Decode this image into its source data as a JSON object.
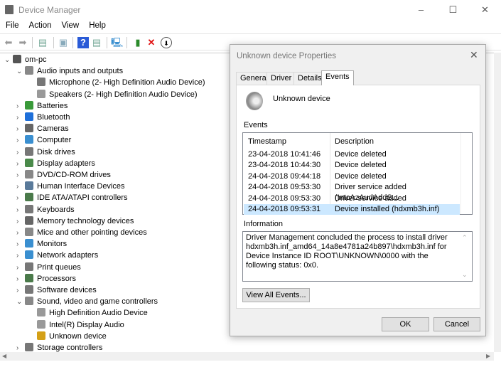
{
  "window": {
    "title": "Device Manager",
    "minimize": "–",
    "maximize": "☐",
    "close": "✕"
  },
  "menu": [
    "File",
    "Action",
    "View",
    "Help"
  ],
  "toolbar": [
    "back-icon",
    "forward-icon",
    "properties-icon",
    "show-hidden-icon",
    "help-icon",
    "run-icon",
    "scan-icon",
    "enable-icon",
    "uninstall-icon",
    "update-driver-icon"
  ],
  "tree": [
    {
      "label": "om-pc",
      "level": 0,
      "exp": "⌄",
      "icon": "#555"
    },
    {
      "label": "Audio inputs and outputs",
      "level": 1,
      "exp": "⌄",
      "icon": "#888"
    },
    {
      "label": "Microphone (2- High Definition Audio Device)",
      "level": 2,
      "exp": "",
      "icon": "#777"
    },
    {
      "label": "Speakers (2- High Definition Audio Device)",
      "level": 2,
      "exp": "",
      "icon": "#999"
    },
    {
      "label": "Batteries",
      "level": 1,
      "exp": "›",
      "icon": "#3a9a3a"
    },
    {
      "label": "Bluetooth",
      "level": 1,
      "exp": "›",
      "icon": "#1e6fd9"
    },
    {
      "label": "Cameras",
      "level": 1,
      "exp": "›",
      "icon": "#666"
    },
    {
      "label": "Computer",
      "level": 1,
      "exp": "›",
      "icon": "#3a8fd0"
    },
    {
      "label": "Disk drives",
      "level": 1,
      "exp": "›",
      "icon": "#777"
    },
    {
      "label": "Display adapters",
      "level": 1,
      "exp": "›",
      "icon": "#4a8a4a"
    },
    {
      "label": "DVD/CD-ROM drives",
      "level": 1,
      "exp": "›",
      "icon": "#888"
    },
    {
      "label": "Human Interface Devices",
      "level": 1,
      "exp": "›",
      "icon": "#5a7a9a"
    },
    {
      "label": "IDE ATA/ATAPI controllers",
      "level": 1,
      "exp": "›",
      "icon": "#4a7a4a"
    },
    {
      "label": "Keyboards",
      "level": 1,
      "exp": "›",
      "icon": "#777"
    },
    {
      "label": "Memory technology devices",
      "level": 1,
      "exp": "›",
      "icon": "#666"
    },
    {
      "label": "Mice and other pointing devices",
      "level": 1,
      "exp": "›",
      "icon": "#888"
    },
    {
      "label": "Monitors",
      "level": 1,
      "exp": "›",
      "icon": "#3a8fd0"
    },
    {
      "label": "Network adapters",
      "level": 1,
      "exp": "›",
      "icon": "#3a8fd0"
    },
    {
      "label": "Print queues",
      "level": 1,
      "exp": "›",
      "icon": "#777"
    },
    {
      "label": "Processors",
      "level": 1,
      "exp": "›",
      "icon": "#4a7a4a"
    },
    {
      "label": "Software devices",
      "level": 1,
      "exp": "›",
      "icon": "#777"
    },
    {
      "label": "Sound, video and game controllers",
      "level": 1,
      "exp": "⌄",
      "icon": "#888"
    },
    {
      "label": "High Definition Audio Device",
      "level": 2,
      "exp": "",
      "icon": "#999"
    },
    {
      "label": "Intel(R) Display Audio",
      "level": 2,
      "exp": "",
      "icon": "#999"
    },
    {
      "label": "Unknown device",
      "level": 2,
      "exp": "",
      "icon": "#d4a017"
    },
    {
      "label": "Storage controllers",
      "level": 1,
      "exp": "›",
      "icon": "#777"
    }
  ],
  "dialog": {
    "title": "Unknown device Properties",
    "close": "✕",
    "tabs": [
      "General",
      "Driver",
      "Details",
      "Events"
    ],
    "active_tab": "Events",
    "device_name": "Unknown device",
    "events_label": "Events",
    "columns": [
      "Timestamp",
      "Description"
    ],
    "events": [
      [
        "23-04-2018 10:41:46",
        "Device deleted"
      ],
      [
        "23-04-2018 10:44:30",
        "Device deleted"
      ],
      [
        "24-04-2018 09:44:18",
        "Device deleted"
      ],
      [
        "24-04-2018 09:53:30",
        "Driver service added (IntcAzAudAddS..."
      ],
      [
        "24-04-2018 09:53:30",
        "Driver service added (DolbyDAXAPI)"
      ],
      [
        "24-04-2018 09:53:31",
        "Device installed (hdxmb3h.inf)"
      ]
    ],
    "selected_index": 5,
    "information_label": "Information",
    "information": "Driver Management concluded the process to install driver hdxmb3h.inf_amd64_14a8e4781a24b897\\hdxmb3h.inf for Device Instance ID ROOT\\UNKNOWN\\0000 with the following status: 0x0.",
    "view_all": "View All Events...",
    "ok": "OK",
    "cancel": "Cancel"
  },
  "colors": {
    "selection": "#cce8ff",
    "accent": "#0078d7"
  }
}
